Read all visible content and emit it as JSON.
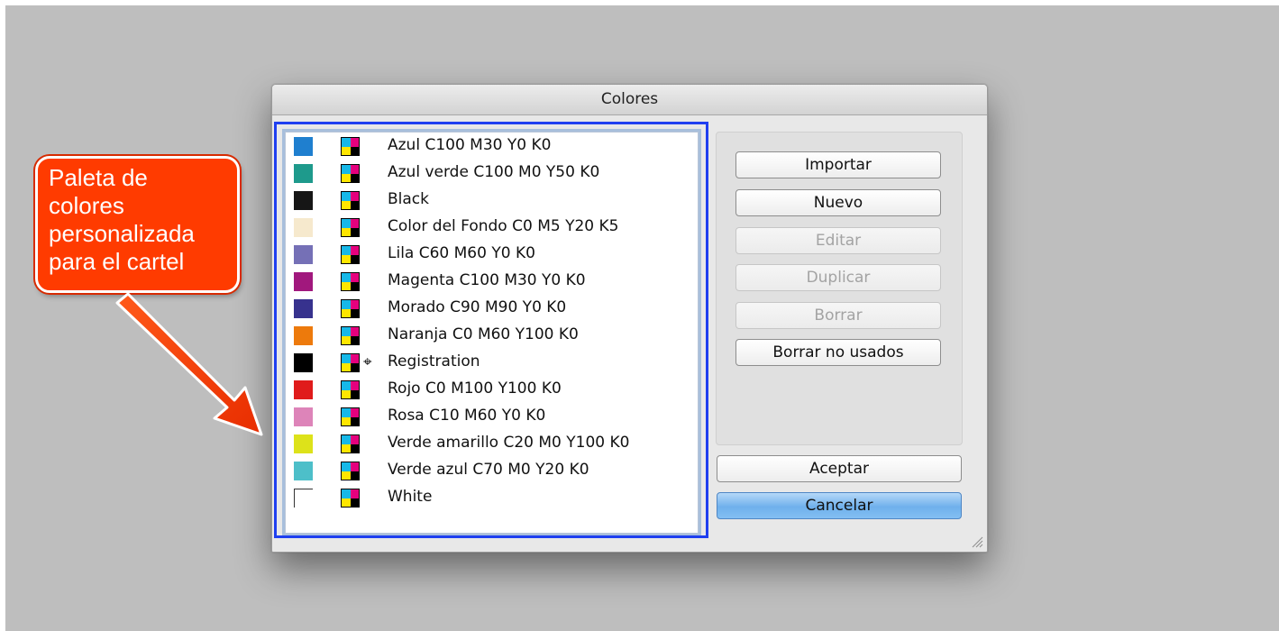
{
  "window": {
    "title": "Colores"
  },
  "colors": [
    {
      "name": "Azul C100 M30 Y0 K0",
      "swatch": "#1f7fcf",
      "cmyk_icon": true,
      "registration": false
    },
    {
      "name": "Azul verde C100 M0 Y50 K0",
      "swatch": "#1e9a8c",
      "cmyk_icon": true,
      "registration": false
    },
    {
      "name": "Black",
      "swatch": "#161616",
      "cmyk_icon": true,
      "registration": false
    },
    {
      "name": "Color del Fondo C0 M5 Y20 K5",
      "swatch": "#f6e9cd",
      "cmyk_icon": true,
      "registration": false
    },
    {
      "name": "Lila C60 M60 Y0 K0",
      "swatch": "#7570b6",
      "cmyk_icon": true,
      "registration": false
    },
    {
      "name": "Magenta C100 M30 Y0 K0",
      "swatch": "#a1187d",
      "cmyk_icon": true,
      "registration": false
    },
    {
      "name": "Morado C90 M90 Y0 K0",
      "swatch": "#37328e",
      "cmyk_icon": true,
      "registration": false
    },
    {
      "name": "Naranja C0 M60 Y100 K0",
      "swatch": "#ed7a0c",
      "cmyk_icon": true,
      "registration": false
    },
    {
      "name": "Registration",
      "swatch": "#000000",
      "cmyk_icon": true,
      "registration": true
    },
    {
      "name": "Rojo C0 M100 Y100 K0",
      "swatch": "#e01b1b",
      "cmyk_icon": true,
      "registration": false
    },
    {
      "name": "Rosa C10 M60 Y0 K0",
      "swatch": "#dd84b9",
      "cmyk_icon": true,
      "registration": false
    },
    {
      "name": "Verde amarillo C20 M0 Y100 K0",
      "swatch": "#dde21a",
      "cmyk_icon": true,
      "registration": false
    },
    {
      "name": "Verde azul C70 M0 Y20 K0",
      "swatch": "#4dbfc9",
      "cmyk_icon": true,
      "registration": false
    },
    {
      "name": "White",
      "swatch": "#ffffff",
      "cmyk_icon": true,
      "registration": false
    }
  ],
  "buttons": {
    "importar": "Importar",
    "nuevo": "Nuevo",
    "editar": "Editar",
    "duplicar": "Duplicar",
    "borrar": "Borrar",
    "borrar_no_usados": "Borrar no usados",
    "aceptar": "Aceptar",
    "cancelar": "Cancelar"
  },
  "annotation": {
    "lines": [
      "Paleta de",
      "colores",
      "personalizada",
      "para el cartel"
    ],
    "color": "#ff3b00",
    "highlight_color": "#1f3ff0"
  },
  "icons": {
    "cmyk": "cmyk-process-icon",
    "registration": "registration-mark-icon"
  }
}
